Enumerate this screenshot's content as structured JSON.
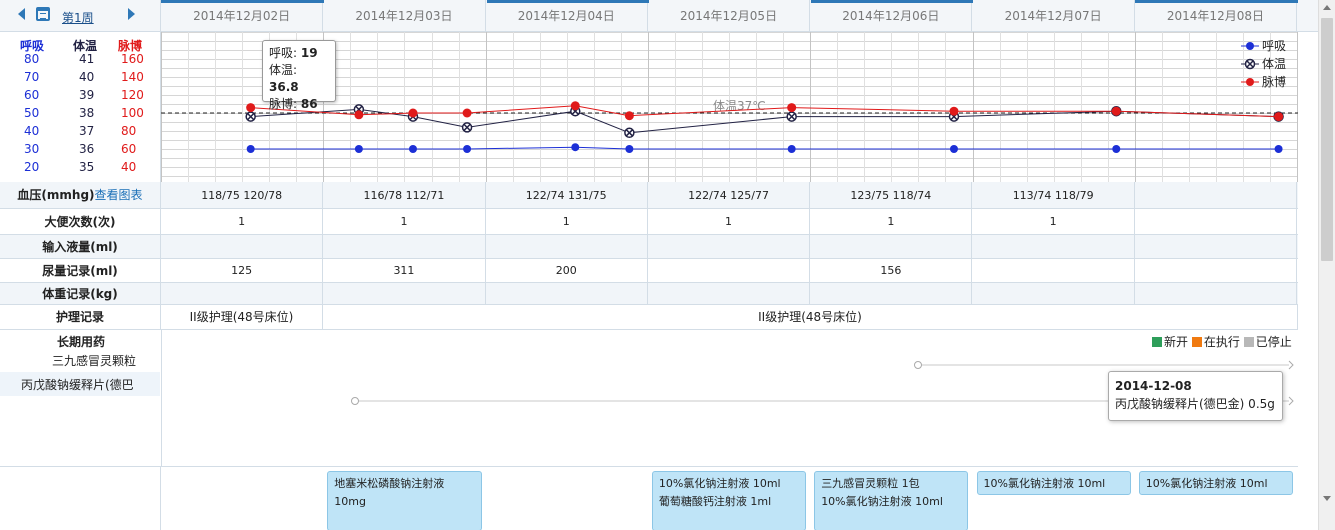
{
  "header": {
    "week_label": "第1周",
    "dates": [
      "2014年12月02日",
      "2014年12月03日",
      "2014年12月04日",
      "2014年12月05日",
      "2014年12月06日",
      "2014年12月07日",
      "2014年12月08日"
    ]
  },
  "scale": {
    "heads": {
      "resp": "呼吸",
      "temp": "体温",
      "pulse": "脉博"
    },
    "resp": [
      "80",
      "70",
      "60",
      "50",
      "40",
      "30",
      "20"
    ],
    "temp": [
      "41",
      "40",
      "39",
      "38",
      "37",
      "36",
      "35"
    ],
    "pulse": [
      "160",
      "140",
      "120",
      "100",
      "80",
      "60",
      "40"
    ],
    "colors": {
      "resp": "#1c2fd6",
      "temp": "#222244",
      "pulse": "#e01a1a"
    }
  },
  "chart_data": {
    "type": "line",
    "y_ranges": {
      "resp": [
        20,
        80
      ],
      "temp": [
        35,
        41
      ],
      "pulse": [
        40,
        160
      ]
    },
    "reference_label": "体温37℃",
    "reference_temp": 37,
    "legend": [
      "呼吸",
      "体温",
      "脉博"
    ],
    "legend_position": "top-right",
    "series": [
      {
        "name": "呼吸",
        "points": [
          {
            "day": 0,
            "slot": 3,
            "value": 20
          },
          {
            "day": 1,
            "slot": 1,
            "value": 20
          },
          {
            "day": 1,
            "slot": 3,
            "value": 20
          },
          {
            "day": 1,
            "slot": 5,
            "value": 20
          },
          {
            "day": 2,
            "slot": 3,
            "value": 21
          },
          {
            "day": 2,
            "slot": 5,
            "value": 20
          },
          {
            "day": 3,
            "slot": 5,
            "value": 20
          },
          {
            "day": 4,
            "slot": 5,
            "value": 20
          },
          {
            "day": 5,
            "slot": 5,
            "value": 20
          },
          {
            "day": 6,
            "slot": 5,
            "value": 20
          }
        ]
      },
      {
        "name": "体温",
        "points": [
          {
            "day": 0,
            "slot": 3,
            "value": 36.8
          },
          {
            "day": 1,
            "slot": 1,
            "value": 37.2
          },
          {
            "day": 1,
            "slot": 3,
            "value": 36.8
          },
          {
            "day": 1,
            "slot": 5,
            "value": 36.2
          },
          {
            "day": 2,
            "slot": 3,
            "value": 37.1
          },
          {
            "day": 2,
            "slot": 5,
            "value": 35.9
          },
          {
            "day": 3,
            "slot": 5,
            "value": 36.8
          },
          {
            "day": 4,
            "slot": 5,
            "value": 36.8
          },
          {
            "day": 5,
            "slot": 5,
            "value": 37.1
          },
          {
            "day": 6,
            "slot": 5,
            "value": 36.8
          }
        ]
      },
      {
        "name": "脉博",
        "points": [
          {
            "day": 0,
            "slot": 3,
            "value": 86
          },
          {
            "day": 1,
            "slot": 1,
            "value": 78
          },
          {
            "day": 1,
            "slot": 3,
            "value": 80
          },
          {
            "day": 1,
            "slot": 5,
            "value": 80
          },
          {
            "day": 2,
            "slot": 3,
            "value": 88
          },
          {
            "day": 2,
            "slot": 5,
            "value": 77
          },
          {
            "day": 3,
            "slot": 5,
            "value": 86
          },
          {
            "day": 4,
            "slot": 5,
            "value": 82
          },
          {
            "day": 5,
            "slot": 5,
            "value": 82
          },
          {
            "day": 6,
            "slot": 5,
            "value": 76
          }
        ]
      }
    ],
    "tooltip": {
      "resp_label": "呼吸:",
      "resp": "19",
      "temp_label": "体温:",
      "temp": "36.8",
      "pulse_label": "脉博:",
      "pulse": "86"
    }
  },
  "table": {
    "bp": {
      "label_prefix": "血压(mmhg)",
      "label_link": "查看图表",
      "values": [
        "118/75 120/78",
        "116/78 112/71",
        "122/74 131/75",
        "122/74 125/77",
        "123/75 118/74",
        "113/74 118/79",
        ""
      ]
    },
    "stool": {
      "label": "大便次数(次)",
      "values": [
        "1",
        "1",
        "1",
        "1",
        "1",
        "1",
        ""
      ]
    },
    "intake": {
      "label": "输入液量(ml)",
      "values": [
        "",
        "",
        "",
        "",
        "",
        "",
        ""
      ]
    },
    "urine": {
      "label": "尿量记录(ml)",
      "values": [
        "125",
        "311",
        "200",
        "",
        "156",
        "",
        ""
      ]
    },
    "weight": {
      "label": "体重记录(kg)",
      "values": [
        "",
        "",
        "",
        "",
        "",
        "",
        ""
      ]
    },
    "nursing": {
      "label": "护理记录",
      "first": "II级护理(48号床位)",
      "rest": "II级护理(48号床位)"
    }
  },
  "meds": {
    "label": "长期用药",
    "items": [
      "三九感冒灵颗粒",
      "丙戊酸钠缓释片(德巴"
    ],
    "status": {
      "new": "新开",
      "active": "在执行",
      "stopped": "已停止"
    },
    "status_colors": {
      "new": "#2e9e5a",
      "active": "#f07a10",
      "stopped": "#b8b8b8"
    },
    "tooltip": {
      "date": "2014-12-08",
      "text": "丙戊酸钠缓释片(德巴金) 0.5g"
    }
  },
  "orders": [
    {
      "day": 1,
      "lines": [
        "地塞米松磷酸钠注射液",
        "10mg"
      ]
    },
    {
      "day": 3,
      "lines": [
        "10%氯化钠注射液 10ml",
        "葡萄糖酸钙注射液 1ml"
      ]
    },
    {
      "day": 4,
      "lines": [
        "三九感冒灵颗粒 1包",
        "10%氯化钠注射液 10ml"
      ]
    },
    {
      "day": 5,
      "lines": [
        "10%氯化钠注射液 10ml"
      ]
    },
    {
      "day": 6,
      "lines": [
        "10%氯化钠注射液 10ml"
      ]
    }
  ]
}
